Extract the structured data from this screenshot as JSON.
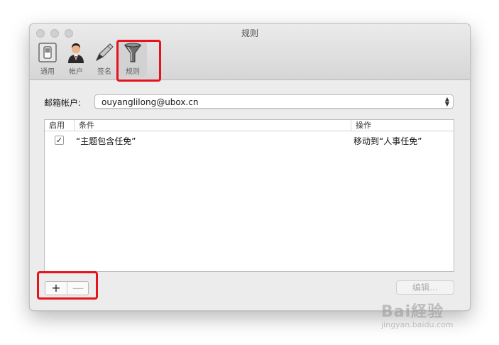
{
  "window": {
    "title": "规则"
  },
  "toolbar": {
    "tabs": [
      {
        "label": "通用",
        "icon": "switch-icon"
      },
      {
        "label": "帐户",
        "icon": "user-icon"
      },
      {
        "label": "签名",
        "icon": "pen-icon"
      },
      {
        "label": "规则",
        "icon": "funnel-icon",
        "selected": true
      }
    ]
  },
  "account": {
    "label": "邮箱帐户:",
    "value": "ouyanglilong@ubox.cn"
  },
  "rules_table": {
    "columns": [
      "启用",
      "条件",
      "操作"
    ],
    "rows": [
      {
        "enabled": true,
        "enabled_mark": "✓",
        "condition": "“主题包含任免”",
        "action": "移动到“人事任免”"
      }
    ]
  },
  "bottom_bar": {
    "add_label": "+",
    "remove_label": "—",
    "edit_label": "编辑…"
  },
  "watermark": {
    "main": "Bai経验",
    "sub": "jingyan.baidu.com"
  },
  "colors": {
    "highlight": "#e8121c",
    "window_bg": "#ececec"
  }
}
